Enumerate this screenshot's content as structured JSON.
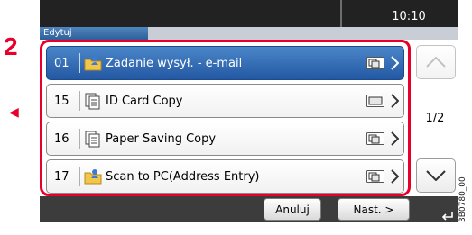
{
  "step": {
    "number": "2"
  },
  "header": {
    "time": "10:10",
    "mode_label": "Edytuj"
  },
  "list": {
    "rows": [
      {
        "num": "01",
        "label": "Zadanie wysył. - e-mail",
        "icon": "folder-user-icon",
        "type_icon": "multi-page-icon",
        "selected": true
      },
      {
        "num": "15",
        "label": "ID Card Copy",
        "icon": "copy-document-icon",
        "type_icon": "single-page-icon",
        "selected": false
      },
      {
        "num": "16",
        "label": "Paper Saving Copy",
        "icon": "copy-document-icon",
        "type_icon": "multi-page-icon",
        "selected": false
      },
      {
        "num": "17",
        "label": "Scan to PC(Address Entry)",
        "icon": "folder-user-icon",
        "type_icon": "multi-page-icon",
        "selected": false
      }
    ]
  },
  "pagination": {
    "current": 1,
    "total": 2,
    "label": "1/2"
  },
  "footer": {
    "cancel_label": "Anuluj",
    "next_label": "Nast. >"
  },
  "figure_code": "3B0780_00",
  "colors": {
    "highlight": "#e8002a",
    "selected_row": "#2f6db3",
    "topbar": "#222222"
  }
}
